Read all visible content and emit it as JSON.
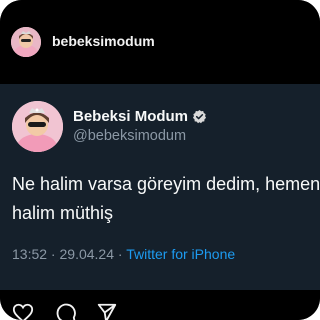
{
  "instagram": {
    "username": "bebeksimodum"
  },
  "tweet": {
    "display_name": "Bebeksi Modum",
    "handle": "@bebeksimodum",
    "text_line1": "Ne halim varsa göreyim dedim, hemen",
    "text_line2": "halim müthiş",
    "time": "13:52",
    "separator": " · ",
    "date": "29.04.24",
    "source": "Twitter for iPhone"
  },
  "icons": {
    "verified": "verified-badge-icon",
    "like": "heart-icon",
    "comment": "comment-icon",
    "share": "send-icon"
  },
  "colors": {
    "tweet_background": "#15202b",
    "link": "#1d9bf0",
    "secondary_text": "#8b98a5"
  }
}
